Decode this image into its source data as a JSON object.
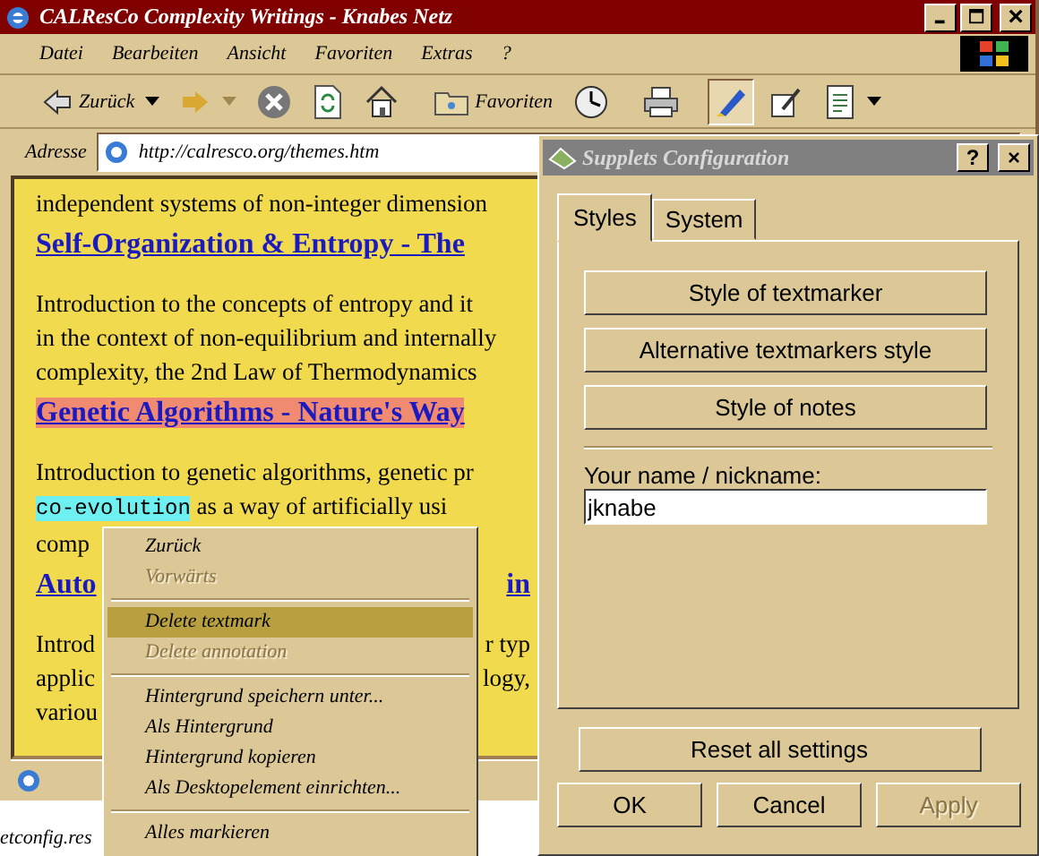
{
  "browser": {
    "title": "CALResCo Complexity Writings - Knabes Netz",
    "menu": [
      "Datei",
      "Bearbeiten",
      "Ansicht",
      "Favoriten",
      "Extras",
      "?"
    ],
    "toolbar": [
      {
        "kind": "back",
        "label": "Zurück"
      },
      {
        "kind": "forward"
      },
      {
        "kind": "stop"
      },
      {
        "kind": "refresh"
      },
      {
        "kind": "home"
      },
      {
        "kind": "favorites",
        "label": "Favoriten"
      },
      {
        "kind": "history"
      },
      {
        "kind": "print"
      },
      {
        "kind": "marker",
        "selected": true
      },
      {
        "kind": "note",
        "selected": false
      },
      {
        "kind": "page"
      }
    ],
    "address_label": "Adresse",
    "address": "http://calresco.org/themes.htm"
  },
  "page": {
    "blocks": [
      {
        "kind": "text",
        "lines": [
          {
            "parts": [
              {
                "text": "independent systems of non-integer dimension"
              }
            ]
          }
        ]
      },
      {
        "kind": "heading",
        "lines": [
          {
            "parts": [
              {
                "text": "Self-Organization & Entropy - The"
              }
            ]
          }
        ]
      },
      {
        "kind": "text",
        "lines": [
          {
            "parts": [
              {
                "text": "Introduction to the concepts of entropy and it"
              }
            ]
          },
          {
            "parts": [
              {
                "text": "in the context of non-equilibrium and internally"
              }
            ]
          },
          {
            "parts": [
              {
                "text": "complexity, the 2nd Law of Thermodynamics"
              }
            ]
          }
        ]
      },
      {
        "kind": "heading",
        "lines": [
          {
            "parts": [
              {
                "text": "Genetic Algorithms - Nature's Way",
                "marked": true
              }
            ]
          }
        ]
      },
      {
        "kind": "text",
        "lines": [
          {
            "parts": [
              {
                "text": "Introduction to genetic algorithms, genetic pr"
              }
            ]
          },
          {
            "parts": [
              {
                "text": "co-evolution",
                "alt_marked": true
              },
              {
                "text": " as a way of artificially usi"
              }
            ]
          },
          {
            "parts": [
              {
                "text": "comp"
              }
            ]
          }
        ]
      },
      {
        "kind": "heading",
        "lines": [
          {
            "parts": [
              {
                "text": "Auto"
              }
            ],
            "right": "in"
          }
        ]
      },
      {
        "kind": "text",
        "lines": [
          {
            "parts": [
              {
                "text": "Introd"
              }
            ],
            "right": "r typ"
          },
          {
            "parts": [
              {
                "text": "applic"
              }
            ],
            "right": "logy,"
          },
          {
            "parts": [
              {
                "text": "variou"
              }
            ]
          }
        ]
      }
    ]
  },
  "desktop_text": "etconfig.res",
  "context_menu": [
    {
      "kind": "item",
      "label": "Zurück",
      "disabled": false,
      "selected": false
    },
    {
      "kind": "item",
      "label": "Vorwärts",
      "disabled": true,
      "selected": false
    },
    {
      "kind": "separator"
    },
    {
      "kind": "item",
      "label": "Delete textmark",
      "disabled": false,
      "selected": true
    },
    {
      "kind": "item",
      "label": "Delete annotation",
      "disabled": true,
      "selected": false
    },
    {
      "kind": "separator"
    },
    {
      "kind": "item",
      "label": "Hintergrund speichern unter...",
      "disabled": false,
      "selected": false
    },
    {
      "kind": "item",
      "label": "Als Hintergrund",
      "disabled": false,
      "selected": false
    },
    {
      "kind": "item",
      "label": "Hintergrund kopieren",
      "disabled": false,
      "selected": false
    },
    {
      "kind": "item",
      "label": "Als Desktopelement einrichten...",
      "disabled": false,
      "selected": false
    },
    {
      "kind": "separator"
    },
    {
      "kind": "item",
      "label": "Alles markieren",
      "disabled": false,
      "selected": false
    }
  ],
  "dialog": {
    "title": "Supplets Configuration",
    "help": "?",
    "close": "×",
    "tabs": [
      {
        "label": "Styles",
        "selected": true
      },
      {
        "label": "System",
        "selected": false
      }
    ],
    "style_buttons": [
      "Style of textmarker",
      "Alternative textmarkers style",
      "Style of notes"
    ],
    "name_label": "Your name / nickname:",
    "name_value": "jknabe",
    "reset": "Reset all settings",
    "buttons": [
      {
        "label": "OK",
        "disabled": false
      },
      {
        "label": "Cancel",
        "disabled": false
      },
      {
        "label": "Apply",
        "disabled": true
      }
    ]
  }
}
